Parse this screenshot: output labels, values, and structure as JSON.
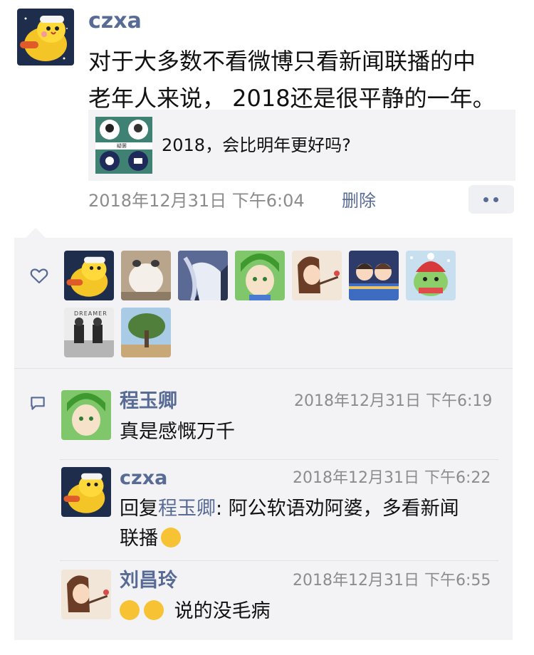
{
  "post": {
    "author": "czxa",
    "text_line1": "对于大多数不看微博只看新闻联播的中",
    "text_line2": "老年人来说， 2018还是很平静的一年。",
    "link_card": {
      "title": "2018，会比明年更好吗?",
      "thumb_label": "疑罢"
    },
    "time": "2018年12月31日 下午6:04",
    "delete_label": "删除",
    "more_icon": "more-dots-icon"
  },
  "likes": {
    "icon": "heart-icon",
    "avatars": [
      "czxa",
      "user-2",
      "user-3",
      "user-4",
      "user-5",
      "user-6",
      "user-7",
      "user-8",
      "user-9"
    ],
    "dreamer_label": "DREAMER"
  },
  "comments": {
    "icon": "comment-icon",
    "items": [
      {
        "name": "程玉卿",
        "time": "2018年12月31日 下午6:19",
        "text": "真是感慨万千"
      },
      {
        "name": "czxa",
        "time": "2018年12月31日 下午6:22",
        "reply_prefix": "回复",
        "reply_to": "程玉卿",
        "text_line1": ": 阿公软语劝阿婆，多看新闻",
        "text_line2": "联播",
        "emoji": "thinking-face"
      },
      {
        "name": "刘昌玲",
        "time": "2018年12月31日 下午6:55",
        "text": "说的没毛病",
        "emoji": "laughing-crying-face"
      }
    ]
  },
  "colors": {
    "link_blue": "#576b95",
    "panel_bg": "#f3f3f5",
    "time_gray": "#8c8c8c"
  }
}
